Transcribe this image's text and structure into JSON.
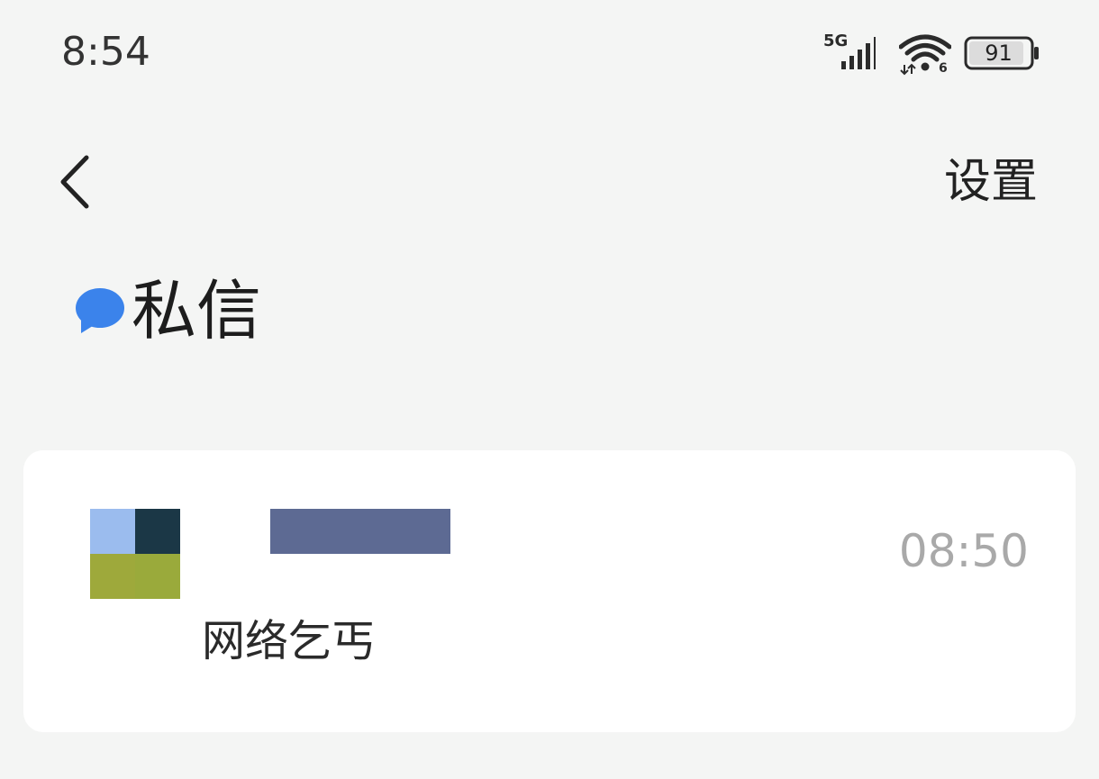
{
  "status_bar": {
    "time": "8:54",
    "network": "5G",
    "battery": "91",
    "icons": [
      "signal-icon",
      "wifi-icon",
      "battery-icon"
    ]
  },
  "nav": {
    "back_icon": "chevron-left-icon",
    "settings_label": "设置"
  },
  "page": {
    "title": "私信",
    "title_icon": "chat-bubble-icon"
  },
  "messages": [
    {
      "sender": "",
      "time": "08:50",
      "preview": "网络乞丐",
      "avatar_colors": [
        "#9bbcee",
        "#1b3746",
        "#9ea93b",
        "#9aaa3b"
      ]
    }
  ],
  "colors": {
    "background": "#f4f5f4",
    "accent": "#3b83eb",
    "card": "#ffffff",
    "muted_text": "#a9a9a9"
  }
}
